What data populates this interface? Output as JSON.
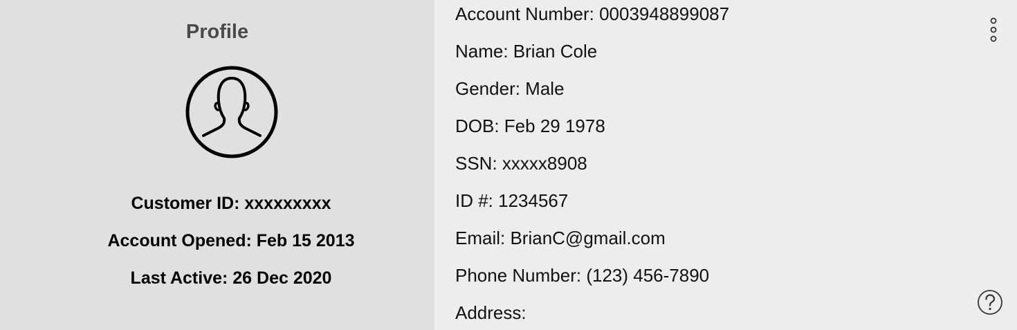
{
  "profile": {
    "title": "Profile",
    "customer_id": "Customer ID: xxxxxxxxx",
    "account_opened": "Account Opened: Feb 15 2013",
    "last_active": "Last Active: 26 Dec 2020"
  },
  "details": {
    "account_number": "Account Number: 0003948899087",
    "name": "Name: Brian Cole",
    "gender": "Gender: Male",
    "dob": "DOB: Feb 29 1978",
    "ssn": "SSN: xxxxx8908",
    "id_number": "ID #: 1234567",
    "email": "Email: BrianC@gmail.com",
    "phone": "Phone Number: (123) 456-7890",
    "address": "Address:"
  },
  "icons": {
    "avatar": "user-avatar-icon",
    "menu": "more-vertical-icon",
    "help": "help-icon"
  }
}
